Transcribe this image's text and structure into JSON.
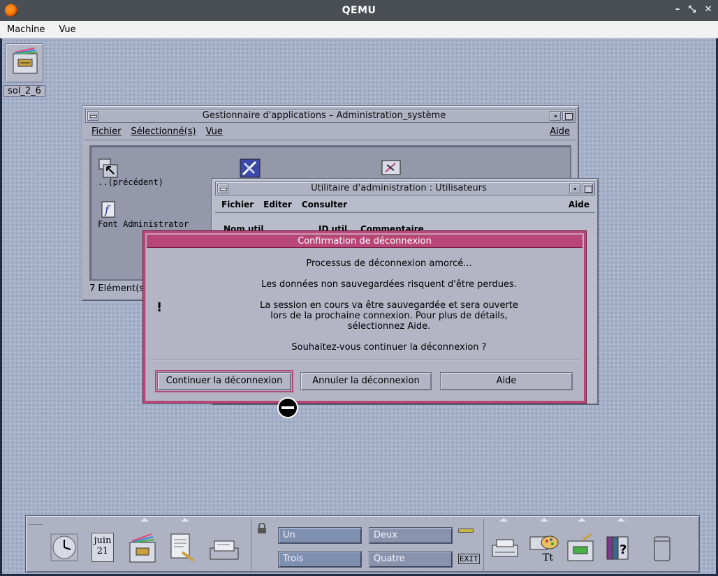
{
  "host": {
    "title": "QEMU",
    "menu": [
      "Machine",
      "Vue"
    ],
    "controls": [
      "–",
      "⤡",
      "✕"
    ]
  },
  "desktop_icon": {
    "label": "sol_2_6"
  },
  "app_manager": {
    "title": "Gestionnaire d'applications – Administration_système",
    "menu": {
      "file": "Fichier",
      "selected": "Sélectionné(s)",
      "view": "Vue",
      "help": "Aide"
    },
    "items": [
      {
        "label": "..(précédent)",
        "icon": "folder-up-icon"
      },
      {
        "label": "Font Administrator",
        "icon": "font-admin-icon"
      }
    ],
    "status": "7 Elément(s)"
  },
  "user_util": {
    "title": "Utilitaire d'administration : Utilisateurs",
    "menu": {
      "file": "Fichier",
      "edit": "Editer",
      "consult": "Consulter",
      "help": "Aide"
    },
    "columns": [
      "Nom util",
      "ID util",
      "Commentaire"
    ]
  },
  "dialog": {
    "title": "Confirmation de déconnexion",
    "lines": [
      "Processus de déconnexion amorcé...",
      "Les données non sauvegardées risquent d'être perdues.",
      "La session en cours va être sauvegardée et sera ouverte",
      "lors de la prochaine connexion. Pour plus de détails,",
      "sélectionnez Aide.",
      "Souhaitez-vous continuer la déconnexion ?"
    ],
    "warning_glyph": "!",
    "buttons": {
      "continue": "Continuer la déconnexion",
      "cancel": "Annuler la déconnexion",
      "help": "Aide"
    }
  },
  "front_panel": {
    "date": {
      "month": "juin",
      "day": "21"
    },
    "workspaces": [
      "Un",
      "Deux",
      "Trois",
      "Quatre"
    ],
    "exit_label": "EXIT"
  },
  "colors": {
    "dialog_accent": "#b84677",
    "desktop": "#a3b0c8",
    "workspace_button": "#7f8fb0"
  }
}
